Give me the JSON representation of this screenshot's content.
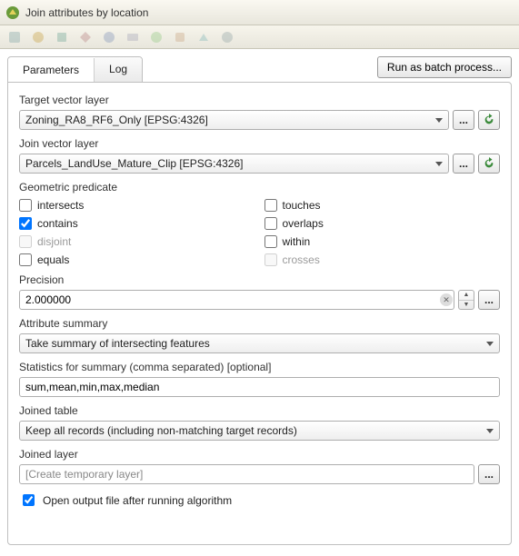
{
  "window": {
    "title": "Join attributes by location"
  },
  "tabs": {
    "parameters": "Parameters",
    "log": "Log"
  },
  "batch_button": "Run as batch process...",
  "labels": {
    "target_layer": "Target vector layer",
    "join_layer": "Join vector layer",
    "geom_predicate": "Geometric predicate",
    "precision": "Precision",
    "attr_summary": "Attribute summary",
    "stats_summary": "Statistics for summary (comma separated) [optional]",
    "joined_table": "Joined table",
    "joined_layer": "Joined layer"
  },
  "target_layer": {
    "value": "Zoning_RA8_RF6_Only [EPSG:4326]"
  },
  "join_layer": {
    "value": "Parcels_LandUse_Mature_Clip [EPSG:4326]"
  },
  "predicates": {
    "intersects": {
      "label": "intersects",
      "checked": false,
      "enabled": true
    },
    "touches": {
      "label": "touches",
      "checked": false,
      "enabled": true
    },
    "contains": {
      "label": "contains",
      "checked": true,
      "enabled": true
    },
    "overlaps": {
      "label": "overlaps",
      "checked": false,
      "enabled": true
    },
    "disjoint": {
      "label": "disjoint",
      "checked": false,
      "enabled": false
    },
    "within": {
      "label": "within",
      "checked": false,
      "enabled": true
    },
    "equals": {
      "label": "equals",
      "checked": false,
      "enabled": true
    },
    "crosses": {
      "label": "crosses",
      "checked": false,
      "enabled": false
    }
  },
  "precision": {
    "value": "2.000000"
  },
  "attr_summary": {
    "value": "Take summary of intersecting features"
  },
  "stats_summary": {
    "value": "sum,mean,min,max,median"
  },
  "joined_table": {
    "value": "Keep all records (including non-matching target records)"
  },
  "joined_layer": {
    "placeholder": "[Create temporary layer]"
  },
  "open_output": {
    "label": "Open output file after running algorithm",
    "checked": true
  },
  "icons": {
    "ellipsis": "...",
    "reload": "reload-icon"
  }
}
